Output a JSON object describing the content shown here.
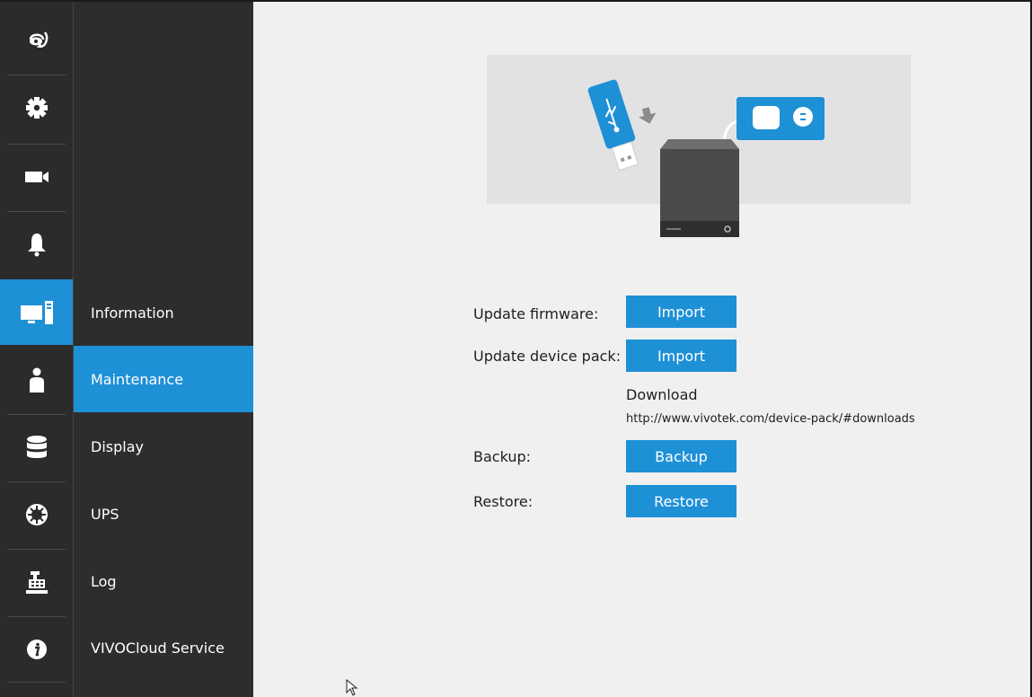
{
  "rail": {
    "items": [
      {
        "icon": "return-icon"
      },
      {
        "icon": "gear-icon"
      },
      {
        "icon": "camera-icon"
      },
      {
        "icon": "bell-icon"
      },
      {
        "icon": "system-monitor-icon",
        "active": true
      },
      {
        "icon": "user-icon"
      },
      {
        "icon": "storage-database-icon"
      },
      {
        "icon": "network-globe-icon"
      },
      {
        "icon": "pos-register-icon"
      },
      {
        "icon": "info-icon"
      }
    ]
  },
  "submenu": {
    "items": [
      {
        "label": "Information"
      },
      {
        "label": "Maintenance",
        "active": true
      },
      {
        "label": "Display"
      },
      {
        "label": "UPS"
      },
      {
        "label": "Log"
      },
      {
        "label": "VIVOCloud Service"
      }
    ]
  },
  "maintenance": {
    "firmware_label": "Update firmware:",
    "firmware_button": "Import",
    "device_pack_label": "Update device pack:",
    "device_pack_button": "Import",
    "download_title": "Download",
    "download_link": "http://www.vivotek.com/device-pack/#downloads",
    "backup_label": "Backup:",
    "backup_button": "Backup",
    "restore_label": "Restore:",
    "restore_button": "Restore"
  },
  "colors": {
    "accent": "#1e90d6",
    "rail_bg": "#2b2b2b",
    "submenu_bg": "#2d2d2d",
    "content_bg": "#f0f0f0"
  }
}
